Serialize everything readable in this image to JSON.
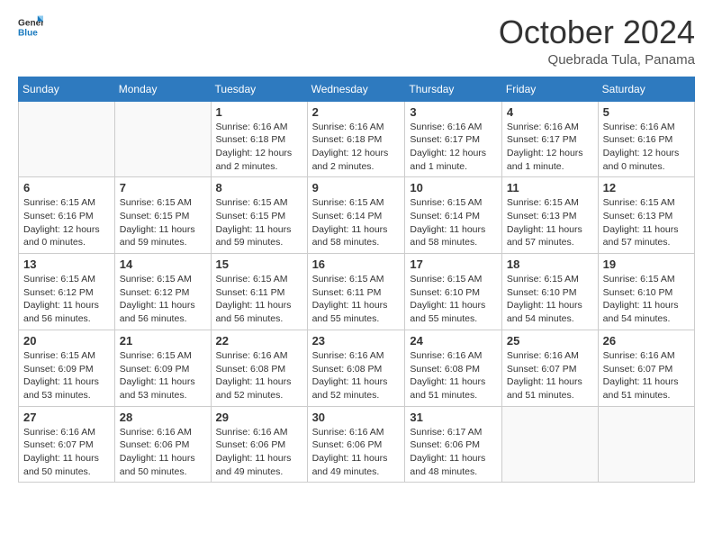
{
  "logo": {
    "line1": "General",
    "line2": "Blue"
  },
  "header": {
    "month": "October 2024",
    "location": "Quebrada Tula, Panama"
  },
  "weekdays": [
    "Sunday",
    "Monday",
    "Tuesday",
    "Wednesday",
    "Thursday",
    "Friday",
    "Saturday"
  ],
  "weeks": [
    [
      {
        "day": "",
        "info": ""
      },
      {
        "day": "",
        "info": ""
      },
      {
        "day": "1",
        "info": "Sunrise: 6:16 AM\nSunset: 6:18 PM\nDaylight: 12 hours and 2 minutes."
      },
      {
        "day": "2",
        "info": "Sunrise: 6:16 AM\nSunset: 6:18 PM\nDaylight: 12 hours and 2 minutes."
      },
      {
        "day": "3",
        "info": "Sunrise: 6:16 AM\nSunset: 6:17 PM\nDaylight: 12 hours and 1 minute."
      },
      {
        "day": "4",
        "info": "Sunrise: 6:16 AM\nSunset: 6:17 PM\nDaylight: 12 hours and 1 minute."
      },
      {
        "day": "5",
        "info": "Sunrise: 6:16 AM\nSunset: 6:16 PM\nDaylight: 12 hours and 0 minutes."
      }
    ],
    [
      {
        "day": "6",
        "info": "Sunrise: 6:15 AM\nSunset: 6:16 PM\nDaylight: 12 hours and 0 minutes."
      },
      {
        "day": "7",
        "info": "Sunrise: 6:15 AM\nSunset: 6:15 PM\nDaylight: 11 hours and 59 minutes."
      },
      {
        "day": "8",
        "info": "Sunrise: 6:15 AM\nSunset: 6:15 PM\nDaylight: 11 hours and 59 minutes."
      },
      {
        "day": "9",
        "info": "Sunrise: 6:15 AM\nSunset: 6:14 PM\nDaylight: 11 hours and 58 minutes."
      },
      {
        "day": "10",
        "info": "Sunrise: 6:15 AM\nSunset: 6:14 PM\nDaylight: 11 hours and 58 minutes."
      },
      {
        "day": "11",
        "info": "Sunrise: 6:15 AM\nSunset: 6:13 PM\nDaylight: 11 hours and 57 minutes."
      },
      {
        "day": "12",
        "info": "Sunrise: 6:15 AM\nSunset: 6:13 PM\nDaylight: 11 hours and 57 minutes."
      }
    ],
    [
      {
        "day": "13",
        "info": "Sunrise: 6:15 AM\nSunset: 6:12 PM\nDaylight: 11 hours and 56 minutes."
      },
      {
        "day": "14",
        "info": "Sunrise: 6:15 AM\nSunset: 6:12 PM\nDaylight: 11 hours and 56 minutes."
      },
      {
        "day": "15",
        "info": "Sunrise: 6:15 AM\nSunset: 6:11 PM\nDaylight: 11 hours and 56 minutes."
      },
      {
        "day": "16",
        "info": "Sunrise: 6:15 AM\nSunset: 6:11 PM\nDaylight: 11 hours and 55 minutes."
      },
      {
        "day": "17",
        "info": "Sunrise: 6:15 AM\nSunset: 6:10 PM\nDaylight: 11 hours and 55 minutes."
      },
      {
        "day": "18",
        "info": "Sunrise: 6:15 AM\nSunset: 6:10 PM\nDaylight: 11 hours and 54 minutes."
      },
      {
        "day": "19",
        "info": "Sunrise: 6:15 AM\nSunset: 6:10 PM\nDaylight: 11 hours and 54 minutes."
      }
    ],
    [
      {
        "day": "20",
        "info": "Sunrise: 6:15 AM\nSunset: 6:09 PM\nDaylight: 11 hours and 53 minutes."
      },
      {
        "day": "21",
        "info": "Sunrise: 6:15 AM\nSunset: 6:09 PM\nDaylight: 11 hours and 53 minutes."
      },
      {
        "day": "22",
        "info": "Sunrise: 6:16 AM\nSunset: 6:08 PM\nDaylight: 11 hours and 52 minutes."
      },
      {
        "day": "23",
        "info": "Sunrise: 6:16 AM\nSunset: 6:08 PM\nDaylight: 11 hours and 52 minutes."
      },
      {
        "day": "24",
        "info": "Sunrise: 6:16 AM\nSunset: 6:08 PM\nDaylight: 11 hours and 51 minutes."
      },
      {
        "day": "25",
        "info": "Sunrise: 6:16 AM\nSunset: 6:07 PM\nDaylight: 11 hours and 51 minutes."
      },
      {
        "day": "26",
        "info": "Sunrise: 6:16 AM\nSunset: 6:07 PM\nDaylight: 11 hours and 51 minutes."
      }
    ],
    [
      {
        "day": "27",
        "info": "Sunrise: 6:16 AM\nSunset: 6:07 PM\nDaylight: 11 hours and 50 minutes."
      },
      {
        "day": "28",
        "info": "Sunrise: 6:16 AM\nSunset: 6:06 PM\nDaylight: 11 hours and 50 minutes."
      },
      {
        "day": "29",
        "info": "Sunrise: 6:16 AM\nSunset: 6:06 PM\nDaylight: 11 hours and 49 minutes."
      },
      {
        "day": "30",
        "info": "Sunrise: 6:16 AM\nSunset: 6:06 PM\nDaylight: 11 hours and 49 minutes."
      },
      {
        "day": "31",
        "info": "Sunrise: 6:17 AM\nSunset: 6:06 PM\nDaylight: 11 hours and 48 minutes."
      },
      {
        "day": "",
        "info": ""
      },
      {
        "day": "",
        "info": ""
      }
    ]
  ]
}
